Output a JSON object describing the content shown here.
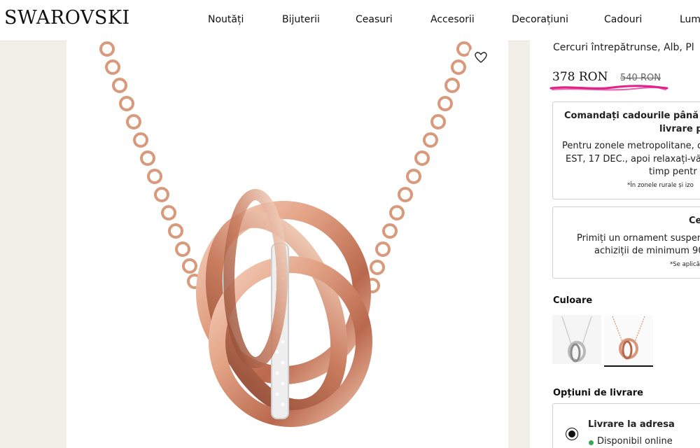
{
  "header": {
    "logo": "SWAROVSKI",
    "nav": [
      "Noutăți",
      "Bijuterii",
      "Ceasuri",
      "Accesorii",
      "Decorațiuni",
      "Cadouri",
      "Lum"
    ]
  },
  "gallery": {
    "image_icon": "necklace-image",
    "wishlist_icon": "heart-icon"
  },
  "product": {
    "subtitle": "Cercuri întrepătrunse, Alb, Pl",
    "price": "378 RON",
    "old_price": "540 RON",
    "accent_color": "#e0218a"
  },
  "promo1": {
    "title_line1": "Comandați cadourile până la",
    "title_line2": "livrare p",
    "body_line1": "Pentru zonele metropolitane, c",
    "body_line2": "EST, 17 DEC., apoi relaxați-vă",
    "body_line3": "timp pentr",
    "note": "*În zonele rurale și izo"
  },
  "promo2": {
    "title": "Ce",
    "body_line1": "Primiți un ornament suspen",
    "body_line2": "achiziții de minimum 90",
    "note": "*Se aplică"
  },
  "color": {
    "label": "Culoare",
    "options": [
      {
        "name": "silver-necklace-swatch",
        "color": "#c8c8c8",
        "selected": false
      },
      {
        "name": "rose-gold-necklace-swatch",
        "color": "#d9967a",
        "selected": true
      }
    ]
  },
  "delivery": {
    "label": "Opțiuni de livrare",
    "option_label": "Livrare la adresa",
    "availability": "Disponibil online",
    "availability_color": "#3aa655"
  }
}
